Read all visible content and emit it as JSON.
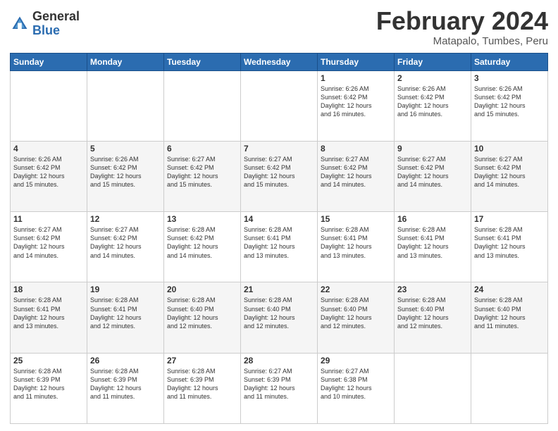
{
  "header": {
    "logo": {
      "general": "General",
      "blue": "Blue"
    },
    "title": "February 2024",
    "location": "Matapalo, Tumbes, Peru"
  },
  "calendar": {
    "days_of_week": [
      "Sunday",
      "Monday",
      "Tuesday",
      "Wednesday",
      "Thursday",
      "Friday",
      "Saturday"
    ],
    "weeks": [
      [
        {
          "day": "",
          "info": ""
        },
        {
          "day": "",
          "info": ""
        },
        {
          "day": "",
          "info": ""
        },
        {
          "day": "",
          "info": ""
        },
        {
          "day": "1",
          "info": "Sunrise: 6:26 AM\nSunset: 6:42 PM\nDaylight: 12 hours\nand 16 minutes."
        },
        {
          "day": "2",
          "info": "Sunrise: 6:26 AM\nSunset: 6:42 PM\nDaylight: 12 hours\nand 16 minutes."
        },
        {
          "day": "3",
          "info": "Sunrise: 6:26 AM\nSunset: 6:42 PM\nDaylight: 12 hours\nand 15 minutes."
        }
      ],
      [
        {
          "day": "4",
          "info": "Sunrise: 6:26 AM\nSunset: 6:42 PM\nDaylight: 12 hours\nand 15 minutes."
        },
        {
          "day": "5",
          "info": "Sunrise: 6:26 AM\nSunset: 6:42 PM\nDaylight: 12 hours\nand 15 minutes."
        },
        {
          "day": "6",
          "info": "Sunrise: 6:27 AM\nSunset: 6:42 PM\nDaylight: 12 hours\nand 15 minutes."
        },
        {
          "day": "7",
          "info": "Sunrise: 6:27 AM\nSunset: 6:42 PM\nDaylight: 12 hours\nand 15 minutes."
        },
        {
          "day": "8",
          "info": "Sunrise: 6:27 AM\nSunset: 6:42 PM\nDaylight: 12 hours\nand 14 minutes."
        },
        {
          "day": "9",
          "info": "Sunrise: 6:27 AM\nSunset: 6:42 PM\nDaylight: 12 hours\nand 14 minutes."
        },
        {
          "day": "10",
          "info": "Sunrise: 6:27 AM\nSunset: 6:42 PM\nDaylight: 12 hours\nand 14 minutes."
        }
      ],
      [
        {
          "day": "11",
          "info": "Sunrise: 6:27 AM\nSunset: 6:42 PM\nDaylight: 12 hours\nand 14 minutes."
        },
        {
          "day": "12",
          "info": "Sunrise: 6:27 AM\nSunset: 6:42 PM\nDaylight: 12 hours\nand 14 minutes."
        },
        {
          "day": "13",
          "info": "Sunrise: 6:28 AM\nSunset: 6:42 PM\nDaylight: 12 hours\nand 14 minutes."
        },
        {
          "day": "14",
          "info": "Sunrise: 6:28 AM\nSunset: 6:41 PM\nDaylight: 12 hours\nand 13 minutes."
        },
        {
          "day": "15",
          "info": "Sunrise: 6:28 AM\nSunset: 6:41 PM\nDaylight: 12 hours\nand 13 minutes."
        },
        {
          "day": "16",
          "info": "Sunrise: 6:28 AM\nSunset: 6:41 PM\nDaylight: 12 hours\nand 13 minutes."
        },
        {
          "day": "17",
          "info": "Sunrise: 6:28 AM\nSunset: 6:41 PM\nDaylight: 12 hours\nand 13 minutes."
        }
      ],
      [
        {
          "day": "18",
          "info": "Sunrise: 6:28 AM\nSunset: 6:41 PM\nDaylight: 12 hours\nand 13 minutes."
        },
        {
          "day": "19",
          "info": "Sunrise: 6:28 AM\nSunset: 6:41 PM\nDaylight: 12 hours\nand 12 minutes."
        },
        {
          "day": "20",
          "info": "Sunrise: 6:28 AM\nSunset: 6:40 PM\nDaylight: 12 hours\nand 12 minutes."
        },
        {
          "day": "21",
          "info": "Sunrise: 6:28 AM\nSunset: 6:40 PM\nDaylight: 12 hours\nand 12 minutes."
        },
        {
          "day": "22",
          "info": "Sunrise: 6:28 AM\nSunset: 6:40 PM\nDaylight: 12 hours\nand 12 minutes."
        },
        {
          "day": "23",
          "info": "Sunrise: 6:28 AM\nSunset: 6:40 PM\nDaylight: 12 hours\nand 12 minutes."
        },
        {
          "day": "24",
          "info": "Sunrise: 6:28 AM\nSunset: 6:40 PM\nDaylight: 12 hours\nand 11 minutes."
        }
      ],
      [
        {
          "day": "25",
          "info": "Sunrise: 6:28 AM\nSunset: 6:39 PM\nDaylight: 12 hours\nand 11 minutes."
        },
        {
          "day": "26",
          "info": "Sunrise: 6:28 AM\nSunset: 6:39 PM\nDaylight: 12 hours\nand 11 minutes."
        },
        {
          "day": "27",
          "info": "Sunrise: 6:28 AM\nSunset: 6:39 PM\nDaylight: 12 hours\nand 11 minutes."
        },
        {
          "day": "28",
          "info": "Sunrise: 6:27 AM\nSunset: 6:39 PM\nDaylight: 12 hours\nand 11 minutes."
        },
        {
          "day": "29",
          "info": "Sunrise: 6:27 AM\nSunset: 6:38 PM\nDaylight: 12 hours\nand 10 minutes."
        },
        {
          "day": "",
          "info": ""
        },
        {
          "day": "",
          "info": ""
        }
      ]
    ]
  }
}
